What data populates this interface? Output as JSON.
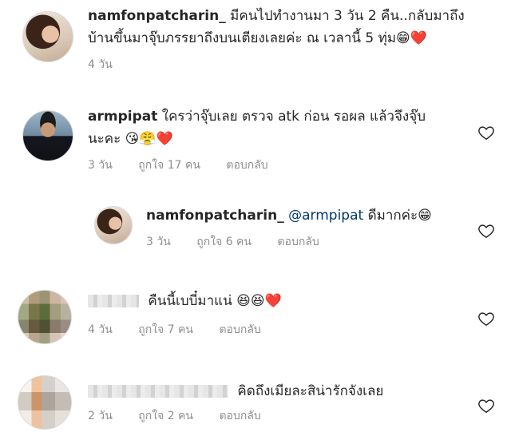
{
  "comments": [
    {
      "username": "namfonpatcharin_",
      "text_line1": "มีคนไปทำงานมา 3 วัน 2 คืน..กลับมาถึง",
      "text_line2": "บ้านขึ้นมาจุ๊บภรรยาถึงบนเตียงเลยค่ะ ณ เวลานี้ 5 ทุ่ม",
      "emojis": "😁❤️",
      "time": "4 วัน"
    },
    {
      "username": "armpipat",
      "text_line1": "ใครว่าจุ๊บเลย ตรวจ atk ก่อน รอผล แล้วจึงจุ๊บ",
      "text_line2": "นะคะ",
      "emojis": "😘😤❤️",
      "time": "3 วัน",
      "likes": "ถูกใจ 17 คน",
      "reply": "ตอบกลับ"
    },
    {
      "username": "namfonpatcharin_",
      "mention": "@armpipat",
      "text": "ดีมากค่ะ",
      "emojis": "😁",
      "time": "3 วัน",
      "likes": "ถูกใจ 6 คน",
      "reply": "ตอบกลับ"
    },
    {
      "text": "คืนนี้เบบี๋มาแน่",
      "emojis": "😆😆❤️",
      "time": "4 วัน",
      "likes": "ถูกใจ 7 คน",
      "reply": "ตอบกลับ"
    },
    {
      "text": "คิดถึงเมียละสิน่ารักจังเลย",
      "time": "2 วัน",
      "likes": "ถูกใจ 2 คน",
      "reply": "ตอบกลับ"
    }
  ]
}
